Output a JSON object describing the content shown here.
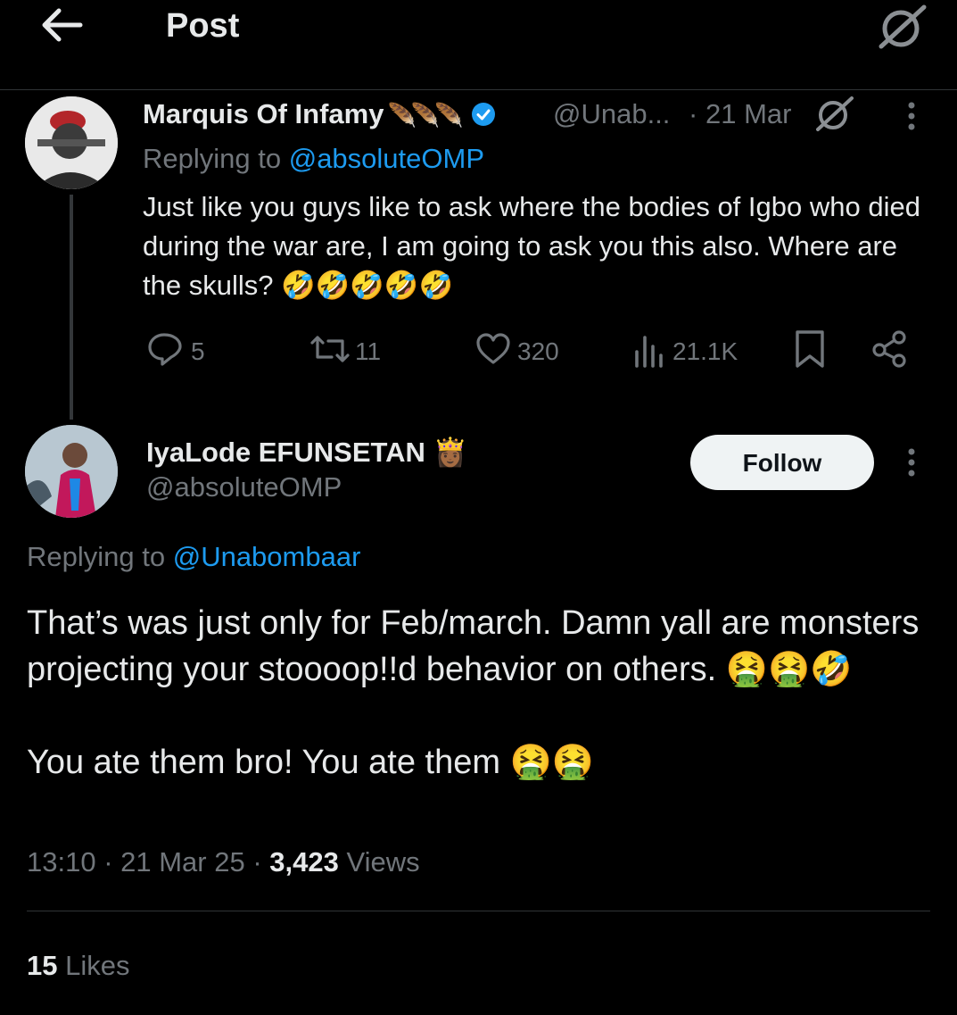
{
  "header": {
    "title": "Post"
  },
  "tweet1": {
    "name": "Marquis Of Infamy",
    "badges": "🪶🪶🪶",
    "handle": "@Unab...",
    "date": "· 21 Mar",
    "replying_prefix": "Replying to ",
    "replying_handle": "@absoluteOMP",
    "text": "Just like you guys like to ask where the bodies of Igbo who died during the war are, I am going to ask you this also. Where are the skulls? 🤣🤣🤣🤣🤣",
    "replies": "5",
    "reposts": "11",
    "likes": "320",
    "views": "21.1K"
  },
  "tweet2": {
    "name": "IyaLode EFUNSETAN",
    "badge": "👸🏾",
    "handle": "@absoluteOMP",
    "follow_label": "Follow",
    "replying_prefix": "Replying to ",
    "replying_handle": "@Unabombaar",
    "text": "That’s was just only for Feb/march. Damn yall are monsters projecting your stoooop!!d behavior on others. 🤮🤮🤣\n\nYou ate them bro! You ate them 🤮🤮",
    "time": "13:10",
    "date": "21 Mar 25",
    "views_count": "3,423",
    "views_label": "Views",
    "likes_count": "15",
    "likes_label": "Likes"
  },
  "colors": {
    "accent": "#1d9bf0",
    "muted": "#71767b",
    "text": "#e7e9ea",
    "bg": "#000000"
  },
  "icons": [
    "back-arrow-icon",
    "grok-icon",
    "verified-icon",
    "reply-icon",
    "repost-icon",
    "like-icon",
    "views-icon",
    "bookmark-icon",
    "share-icon",
    "more-icon"
  ]
}
